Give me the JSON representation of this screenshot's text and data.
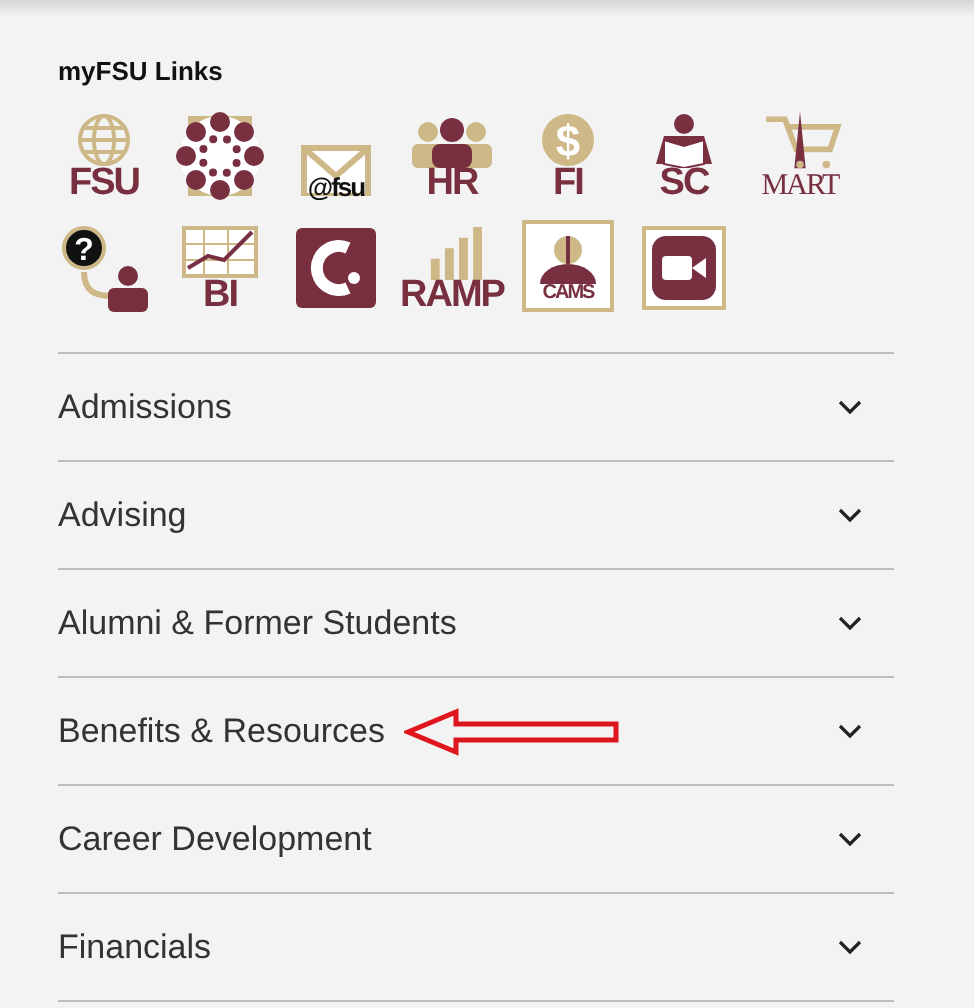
{
  "links_title": "myFSU Links",
  "link_rows": [
    [
      {
        "kind": "globe",
        "label": "FSU"
      },
      {
        "kind": "canvas"
      },
      {
        "kind": "mail",
        "label": "@fsu"
      },
      {
        "kind": "hr",
        "label": "HR"
      },
      {
        "kind": "coin",
        "label": "FI",
        "glyph": "$"
      },
      {
        "kind": "reader",
        "label": "SC"
      },
      {
        "kind": "cart",
        "label": "MART"
      }
    ],
    [
      {
        "kind": "help",
        "glyph": "?"
      },
      {
        "kind": "chart",
        "label": "BI"
      },
      {
        "kind": "clogo"
      },
      {
        "kind": "bars",
        "label": "RAMP"
      },
      {
        "kind": "cams",
        "label": "CAMS"
      },
      {
        "kind": "video"
      }
    ]
  ],
  "sections": [
    {
      "label": "Admissions",
      "expanded": false,
      "annotated": false
    },
    {
      "label": "Advising",
      "expanded": false,
      "annotated": false
    },
    {
      "label": "Alumni & Former Students",
      "expanded": false,
      "annotated": false
    },
    {
      "label": "Benefits & Resources",
      "expanded": false,
      "annotated": true
    },
    {
      "label": "Career Development",
      "expanded": false,
      "annotated": false
    },
    {
      "label": "Financials",
      "expanded": false,
      "annotated": false
    }
  ]
}
